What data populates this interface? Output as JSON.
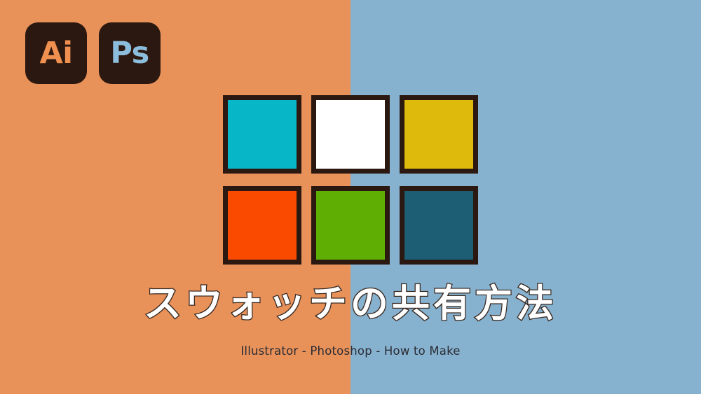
{
  "background": {
    "left_color": "#e8925a",
    "right_color": "#86b2cf",
    "split_percent": 50
  },
  "app_icons": [
    {
      "name": "adobe-illustrator",
      "label": "Ai",
      "tile_color": "#2b1810",
      "text_color": "#f09050"
    },
    {
      "name": "adobe-photoshop",
      "label": "Ps",
      "tile_color": "#2b1810",
      "text_color": "#8dbddc"
    }
  ],
  "swatches": [
    {
      "name": "swatch-cyan",
      "color": "#07b6c7"
    },
    {
      "name": "swatch-white",
      "color": "#ffffff"
    },
    {
      "name": "swatch-yellow",
      "color": "#ddba0b"
    },
    {
      "name": "swatch-orange-red",
      "color": "#f94a00"
    },
    {
      "name": "swatch-green",
      "color": "#5fae03"
    },
    {
      "name": "swatch-dark-teal",
      "color": "#1d5e74"
    }
  ],
  "swatch_border_color": "#2b1810",
  "title": "スウォッチの共有方法",
  "subtitle": "Illustrator - Photoshop - How to Make",
  "title_color": "#ffffff",
  "title_outline_color": "#3a2a22",
  "subtitle_color": "#2b2b33"
}
